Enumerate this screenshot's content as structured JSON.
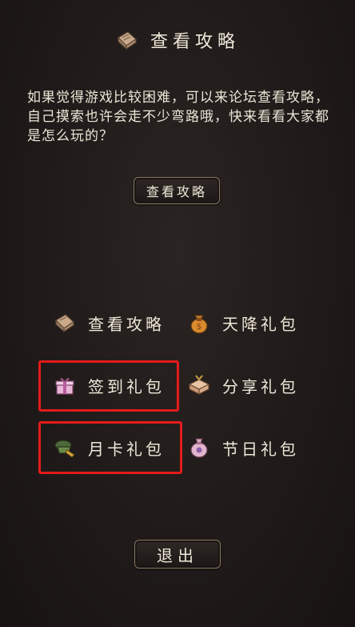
{
  "header": {
    "title": "查看攻略",
    "icon": "scroll-icon"
  },
  "description": "如果觉得游戏比较困难，可以来论坛查看攻略，自己摸索也许会走不少弯路哦，快来看看大家都是怎么玩的？",
  "guide_button": {
    "label": "查看攻略"
  },
  "menu": [
    {
      "id": "guide",
      "label": "查看攻略",
      "icon": "scroll-icon"
    },
    {
      "id": "sky-gift",
      "label": "天降礼包",
      "icon": "money-bag-icon"
    },
    {
      "id": "signin-gift",
      "label": "签到礼包",
      "icon": "gift-box-icon",
      "highlighted": true
    },
    {
      "id": "share-gift",
      "label": "分享礼包",
      "icon": "package-icon"
    },
    {
      "id": "monthly-gift",
      "label": "月卡礼包",
      "icon": "monthly-card-icon",
      "highlighted": true
    },
    {
      "id": "holiday-gift",
      "label": "节日礼包",
      "icon": "pouch-icon"
    }
  ],
  "exit_button": {
    "label": "退出"
  },
  "colors": {
    "highlight": "#e31b1b",
    "button_border": "#8a7860",
    "background": "#1f1a19"
  }
}
